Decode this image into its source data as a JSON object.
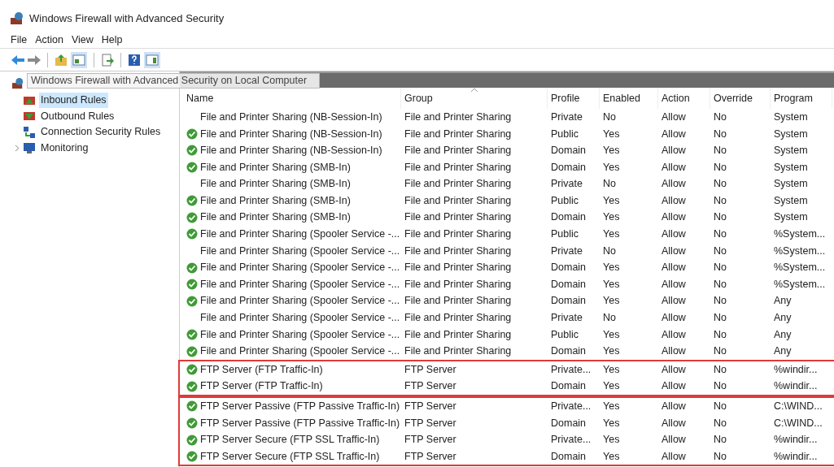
{
  "window": {
    "title": "Windows Firewall with Advanced Security"
  },
  "menu": [
    "File",
    "Action",
    "View",
    "Help"
  ],
  "tooltip": "Windows Firewall with Advanced Security on Local Computer",
  "sidebar": {
    "items": [
      {
        "label": "Inbound Rules",
        "selected": true,
        "expandable": false
      },
      {
        "label": "Outbound Rules",
        "selected": false,
        "expandable": false
      },
      {
        "label": "Connection Security Rules",
        "selected": false,
        "expandable": false
      },
      {
        "label": "Monitoring",
        "selected": false,
        "expandable": true
      }
    ]
  },
  "table": {
    "columns": [
      {
        "label": "Name",
        "sorted": false
      },
      {
        "label": "Group",
        "sorted": true
      },
      {
        "label": "Profile",
        "sorted": false
      },
      {
        "label": "Enabled",
        "sorted": false
      },
      {
        "label": "Action",
        "sorted": false
      },
      {
        "label": "Override",
        "sorted": false
      },
      {
        "label": "Program",
        "sorted": false
      }
    ],
    "sections": [
      {
        "outlined": false,
        "rows": [
          {
            "active": false,
            "cells": [
              "File and Printer Sharing (NB-Session-In)",
              "File and Printer Sharing",
              "Private",
              "No",
              "Allow",
              "No",
              "System"
            ]
          },
          {
            "active": true,
            "cells": [
              "File and Printer Sharing (NB-Session-In)",
              "File and Printer Sharing",
              "Public",
              "Yes",
              "Allow",
              "No",
              "System"
            ]
          },
          {
            "active": true,
            "cells": [
              "File and Printer Sharing (NB-Session-In)",
              "File and Printer Sharing",
              "Domain",
              "Yes",
              "Allow",
              "No",
              "System"
            ]
          },
          {
            "active": true,
            "cells": [
              "File and Printer Sharing (SMB-In)",
              "File and Printer Sharing",
              "Domain",
              "Yes",
              "Allow",
              "No",
              "System"
            ]
          },
          {
            "active": false,
            "cells": [
              "File and Printer Sharing (SMB-In)",
              "File and Printer Sharing",
              "Private",
              "No",
              "Allow",
              "No",
              "System"
            ]
          },
          {
            "active": true,
            "cells": [
              "File and Printer Sharing (SMB-In)",
              "File and Printer Sharing",
              "Public",
              "Yes",
              "Allow",
              "No",
              "System"
            ]
          },
          {
            "active": true,
            "cells": [
              "File and Printer Sharing (SMB-In)",
              "File and Printer Sharing",
              "Domain",
              "Yes",
              "Allow",
              "No",
              "System"
            ]
          },
          {
            "active": true,
            "cells": [
              "File and Printer Sharing (Spooler Service -...",
              "File and Printer Sharing",
              "Public",
              "Yes",
              "Allow",
              "No",
              "%System..."
            ]
          },
          {
            "active": false,
            "cells": [
              "File and Printer Sharing (Spooler Service -...",
              "File and Printer Sharing",
              "Private",
              "No",
              "Allow",
              "No",
              "%System..."
            ]
          },
          {
            "active": true,
            "cells": [
              "File and Printer Sharing (Spooler Service -...",
              "File and Printer Sharing",
              "Domain",
              "Yes",
              "Allow",
              "No",
              "%System..."
            ]
          },
          {
            "active": true,
            "cells": [
              "File and Printer Sharing (Spooler Service -...",
              "File and Printer Sharing",
              "Domain",
              "Yes",
              "Allow",
              "No",
              "%System..."
            ]
          },
          {
            "active": true,
            "cells": [
              "File and Printer Sharing (Spooler Service -...",
              "File and Printer Sharing",
              "Domain",
              "Yes",
              "Allow",
              "No",
              "Any"
            ]
          },
          {
            "active": false,
            "cells": [
              "File and Printer Sharing (Spooler Service -...",
              "File and Printer Sharing",
              "Private",
              "No",
              "Allow",
              "No",
              "Any"
            ]
          },
          {
            "active": true,
            "cells": [
              "File and Printer Sharing (Spooler Service -...",
              "File and Printer Sharing",
              "Public",
              "Yes",
              "Allow",
              "No",
              "Any"
            ]
          },
          {
            "active": true,
            "cells": [
              "File and Printer Sharing (Spooler Service -...",
              "File and Printer Sharing",
              "Domain",
              "Yes",
              "Allow",
              "No",
              "Any"
            ]
          }
        ]
      },
      {
        "outlined": true,
        "rows": [
          {
            "active": true,
            "cells": [
              "FTP Server (FTP Traffic-In)",
              "FTP Server",
              "Private...",
              "Yes",
              "Allow",
              "No",
              "%windir..."
            ]
          },
          {
            "active": true,
            "cells": [
              "FTP Server (FTP Traffic-In)",
              "FTP Server",
              "Domain",
              "Yes",
              "Allow",
              "No",
              "%windir..."
            ]
          }
        ]
      },
      {
        "outlined": true,
        "rows": [
          {
            "active": true,
            "cells": [
              "FTP Server Passive (FTP Passive Traffic-In)",
              "FTP Server",
              "Private...",
              "Yes",
              "Allow",
              "No",
              "C:\\WIND..."
            ]
          },
          {
            "active": true,
            "cells": [
              "FTP Server Passive (FTP Passive Traffic-In)",
              "FTP Server",
              "Domain",
              "Yes",
              "Allow",
              "No",
              "C:\\WIND..."
            ]
          },
          {
            "active": true,
            "cells": [
              "FTP Server Secure (FTP SSL Traffic-In)",
              "FTP Server",
              "Private...",
              "Yes",
              "Allow",
              "No",
              "%windir..."
            ]
          },
          {
            "active": true,
            "cells": [
              "FTP Server Secure (FTP SSL Traffic-In)",
              "FTP Server",
              "Domain",
              "Yes",
              "Allow",
              "No",
              "%windir..."
            ]
          }
        ]
      }
    ]
  }
}
